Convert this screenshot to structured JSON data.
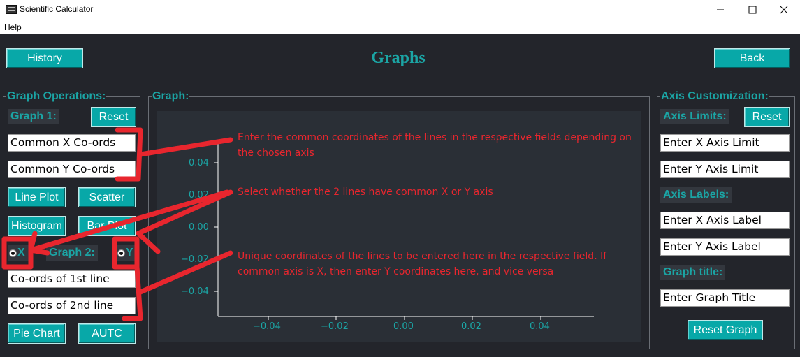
{
  "window": {
    "title": "Scientific Calculator",
    "menu": [
      "Help"
    ]
  },
  "header": {
    "history_label": "History",
    "title": "Graphs",
    "back_label": "Back"
  },
  "graph_operations": {
    "frame_label": "Graph Operations:",
    "graph1_label": "Graph 1:",
    "reset_label": "Reset",
    "common_x_value": "Common X Co-ords",
    "common_y_value": "Common Y Co-ords",
    "line_plot_label": "Line Plot",
    "scatter_label": "Scatter",
    "histogram_label": "Histogram",
    "bar_plot_label": "Bar Plot",
    "radio_x_label": "X",
    "graph2_label": "Graph 2:",
    "radio_y_label": "Y",
    "radio_selected": "X",
    "line1_value": "Co-ords of 1st line",
    "line2_value": "Co-ords of 2nd line",
    "pie_chart_label": "Pie Chart",
    "autc_label": "AUTC"
  },
  "graph": {
    "frame_label": "Graph:",
    "y_ticks": [
      "0.04",
      "0.02",
      "0.00",
      "−0.02",
      "−0.04"
    ],
    "x_ticks": [
      "−0.04",
      "−0.02",
      "0.00",
      "0.02",
      "0.04"
    ]
  },
  "axis_customization": {
    "frame_label": "Axis Customization:",
    "axis_limits_label": "Axis Limits:",
    "reset_label": "Reset",
    "x_limit_value": "Enter X Axis Limit",
    "y_limit_value": "Enter Y Axis Limit",
    "axis_labels_label": "Axis Labels:",
    "x_label_value": "Enter X Axis Label",
    "y_label_value": "Enter Y Axis Label",
    "graph_title_label": "Graph title:",
    "graph_title_value": "Enter Graph Title",
    "reset_graph_label": "Reset Graph"
  },
  "annotations": {
    "common_coords": "Enter the common coordinates of the lines in the respective fields depending on the chosen axis",
    "axis_select": "Select whether the 2 lines have common X or Y axis",
    "unique_coords": "Unique coordinates of the lines to be entered here in the respective field. If common axis is X, then enter Y coordinates here, and vice versa"
  },
  "colors": {
    "background": "#23252b",
    "accent": "#1ba5a5",
    "button": "#08a8a8",
    "annotation": "#e8262e"
  }
}
